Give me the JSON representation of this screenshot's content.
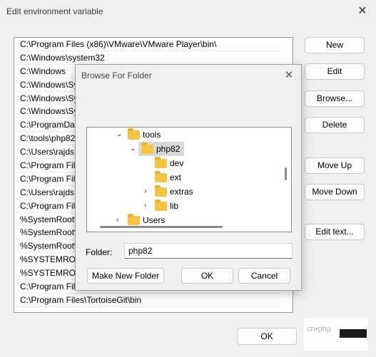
{
  "window": {
    "title": "Edit environment variable",
    "close_glyph": "✕"
  },
  "list": {
    "rows": [
      "C:\\Program Files (x86)\\VMware\\VMware Player\\bin\\",
      "C:\\Windows\\system32",
      "C:\\Windows",
      "C:\\Windows\\Sy",
      "C:\\Windows\\Sy",
      "C:\\Windows\\Sy",
      "C:\\ProgramDat",
      "C:\\tools\\php82",
      "C:\\Users\\rajds",
      "C:\\Program Fil",
      "C:\\Program Fil",
      "C:\\Users\\rajds",
      "C:\\Program Fil",
      "%SystemRoot%",
      "%SystemRoot%",
      "%SystemRoot%",
      "%SYSTEMROOT",
      "%SYSTEMROOT",
      "C:\\Program Fil",
      "C:\\Program Files\\TortoiseGit\\bin"
    ]
  },
  "buttons": {
    "new": "New",
    "edit": "Edit",
    "browse": "Browse...",
    "delete": "Delete",
    "move_up": "Move Up",
    "move_down": "Move Down",
    "edit_text": "Edit text...",
    "ok": "OK"
  },
  "browse_dialog": {
    "title": "Browse For Folder",
    "close_glyph": "✕",
    "tree": {
      "items": [
        {
          "label": "tools",
          "chevron": "⌄",
          "icon": "folder-icon"
        },
        {
          "label": "php82",
          "chevron": "⌄",
          "icon": "folder-icon",
          "selected": true
        },
        {
          "label": "dev",
          "chevron": "",
          "icon": "folder-icon"
        },
        {
          "label": "ext",
          "chevron": "",
          "icon": "folder-icon"
        },
        {
          "label": "extras",
          "chevron": "›",
          "icon": "folder-icon"
        },
        {
          "label": "lib",
          "chevron": "›",
          "icon": "folder-icon"
        },
        {
          "label": "Users",
          "chevron": "›",
          "icon": "folder-icon"
        }
      ]
    },
    "folder_label": "Folder:",
    "folder_value": "php82",
    "make_new_folder": "Make New Folder",
    "ok": "OK",
    "cancel": "Cancel"
  },
  "partial_overlay": {
    "mark_text": "cn•php"
  }
}
